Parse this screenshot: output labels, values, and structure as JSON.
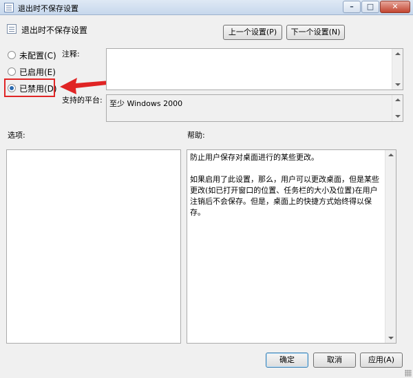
{
  "window": {
    "title": "退出时不保存设置",
    "min": "–",
    "max": "□",
    "close": "✕"
  },
  "header": {
    "title": "退出时不保存设置",
    "prev_button": "上一个设置(P)",
    "next_button": "下一个设置(N)"
  },
  "radios": [
    {
      "label": "未配置(C)",
      "checked": false
    },
    {
      "label": "已启用(E)",
      "checked": false
    },
    {
      "label": "已禁用(D)",
      "checked": true
    }
  ],
  "comment": {
    "label": "注释:",
    "value": ""
  },
  "platform": {
    "label": "支持的平台:",
    "value": "至少 Windows 2000"
  },
  "options": {
    "label": "选项:"
  },
  "help": {
    "label": "帮助:",
    "paragraphs": [
      "防止用户保存对桌面进行的某些更改。",
      "如果启用了此设置，那么，用户可以更改桌面，但是某些更改(如已打开窗口的位置、任务栏的大小及位置)在用户注销后不会保存。但是，桌面上的快捷方式始终得以保存。"
    ]
  },
  "footer": {
    "ok_button": "确定",
    "cancel_button": "取消",
    "apply_button": "应用(A)"
  },
  "colors": {
    "highlight": "#e02424",
    "arrow": "#e02424"
  },
  "icons": {
    "window_icon": "policy-icon",
    "arrow": "red-arrow-annotation"
  }
}
